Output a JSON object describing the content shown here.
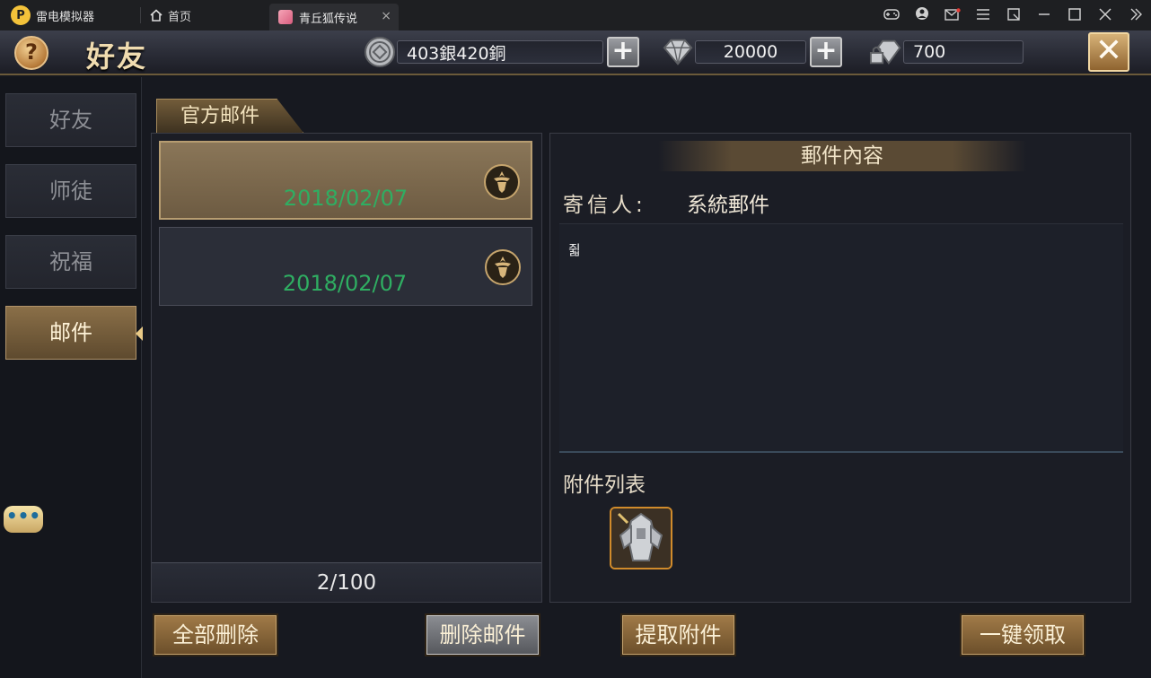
{
  "emulator": {
    "app_name": "雷电模拟器",
    "home_tab": "首页",
    "game_tab": "青丘狐传说",
    "close_tab_glyph": "×"
  },
  "game_header": {
    "help_glyph": "?",
    "title": "好友",
    "silver_copper": "403銀420銅",
    "diamonds": "20000",
    "bound_currency": "700",
    "plus_glyph": "+",
    "close_glyph": "✕"
  },
  "sidebar": {
    "items": [
      {
        "label": "好友",
        "active": false
      },
      {
        "label": "师徒",
        "active": false
      },
      {
        "label": "祝福",
        "active": false
      },
      {
        "label": "邮件",
        "active": true
      }
    ],
    "chat_glyph": "•••"
  },
  "mail_list": {
    "section_tab": "官方邮件",
    "items": [
      {
        "date": "2018/02/07",
        "selected": true
      },
      {
        "date": "2018/02/07",
        "selected": false
      }
    ],
    "count": "2/100"
  },
  "mail_detail": {
    "header": "郵件內容",
    "sender_label": "寄信人:",
    "sender_value": "系統郵件",
    "body": "쥛",
    "attachments_label": "附件列表"
  },
  "actions": {
    "delete_all": "全部删除",
    "delete_mail": "删除邮件",
    "extract_attachment": "提取附件",
    "claim_all": "一键领取"
  }
}
